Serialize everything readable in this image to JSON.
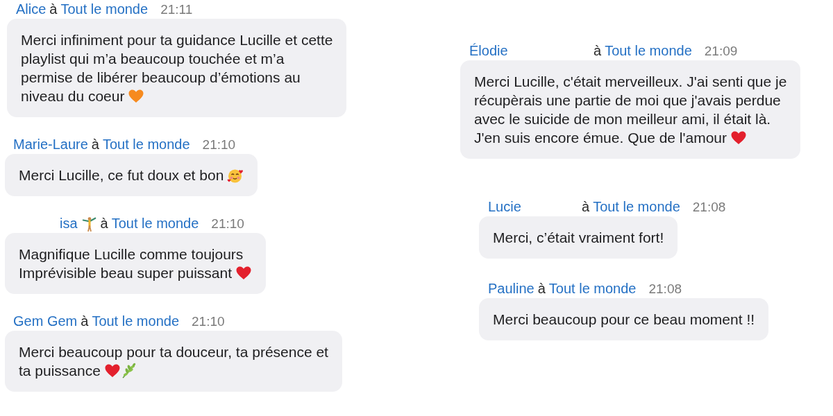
{
  "columns": [
    {
      "messages": [
        {
          "sender": "Alice",
          "to": "à",
          "recipient": "Tout le monde",
          "time": "21:11",
          "lines": [
            "Merci infiniment pour ta guidance Lucille et cette",
            "playlist qui m’a beaucoup touchée et m’a",
            "permise de libérer beaucoup d’émotions au",
            "niveau du coeur"
          ],
          "emojis": [
            {
              "kind": "heart",
              "color": "#f68a1e"
            }
          ]
        },
        {
          "sender": "Marie-Laure",
          "to": "à",
          "recipient": "Tout le monde",
          "time": "21:10",
          "lines": [
            "Merci Lucille, ce fut doux et bon"
          ],
          "emojis": [
            {
              "kind": "smiley-hearts"
            }
          ]
        },
        {
          "sender": "isa",
          "sender_emojis": [
            {
              "kind": "gymnast"
            }
          ],
          "to": "à",
          "recipient": "Tout le monde",
          "time": "21:10",
          "lines": [
            "Magnifique Lucille comme toujours",
            "Imprévisible beau super puissant"
          ],
          "emojis": [
            {
              "kind": "heart",
              "color": "#e3202d"
            }
          ]
        },
        {
          "sender": "Gem Gem",
          "to": "à",
          "recipient": "Tout le monde",
          "time": "21:10",
          "lines": [
            "Merci beaucoup pour ta douceur, ta présence et",
            "ta puissance"
          ],
          "emojis": [
            {
              "kind": "heart",
              "color": "#e3202d"
            },
            {
              "kind": "leaf"
            }
          ]
        }
      ]
    },
    {
      "messages": [
        {
          "sender": "Élodie",
          "to": "à",
          "recipient": "Tout le monde",
          "time": "21:09",
          "lines": [
            "Merci Lucille, c'était merveilleux. J'ai senti que je",
            "récupèrais une partie de moi que j'avais perdue",
            "avec le suicide de mon meilleur ami, il était là.",
            "J'en suis encore émue. Que de l'amour"
          ],
          "emojis": [
            {
              "kind": "heart",
              "color": "#e3202d"
            }
          ]
        },
        {
          "sender": "Lucie",
          "to": "à",
          "recipient": "Tout le monde",
          "time": "21:08",
          "lines": [
            "Merci, c’était vraiment fort!"
          ]
        },
        {
          "sender": "Pauline",
          "to": "à",
          "recipient": "Tout le monde",
          "time": "21:08",
          "lines": [
            "Merci beaucoup pour ce beau moment !!"
          ]
        }
      ]
    }
  ]
}
